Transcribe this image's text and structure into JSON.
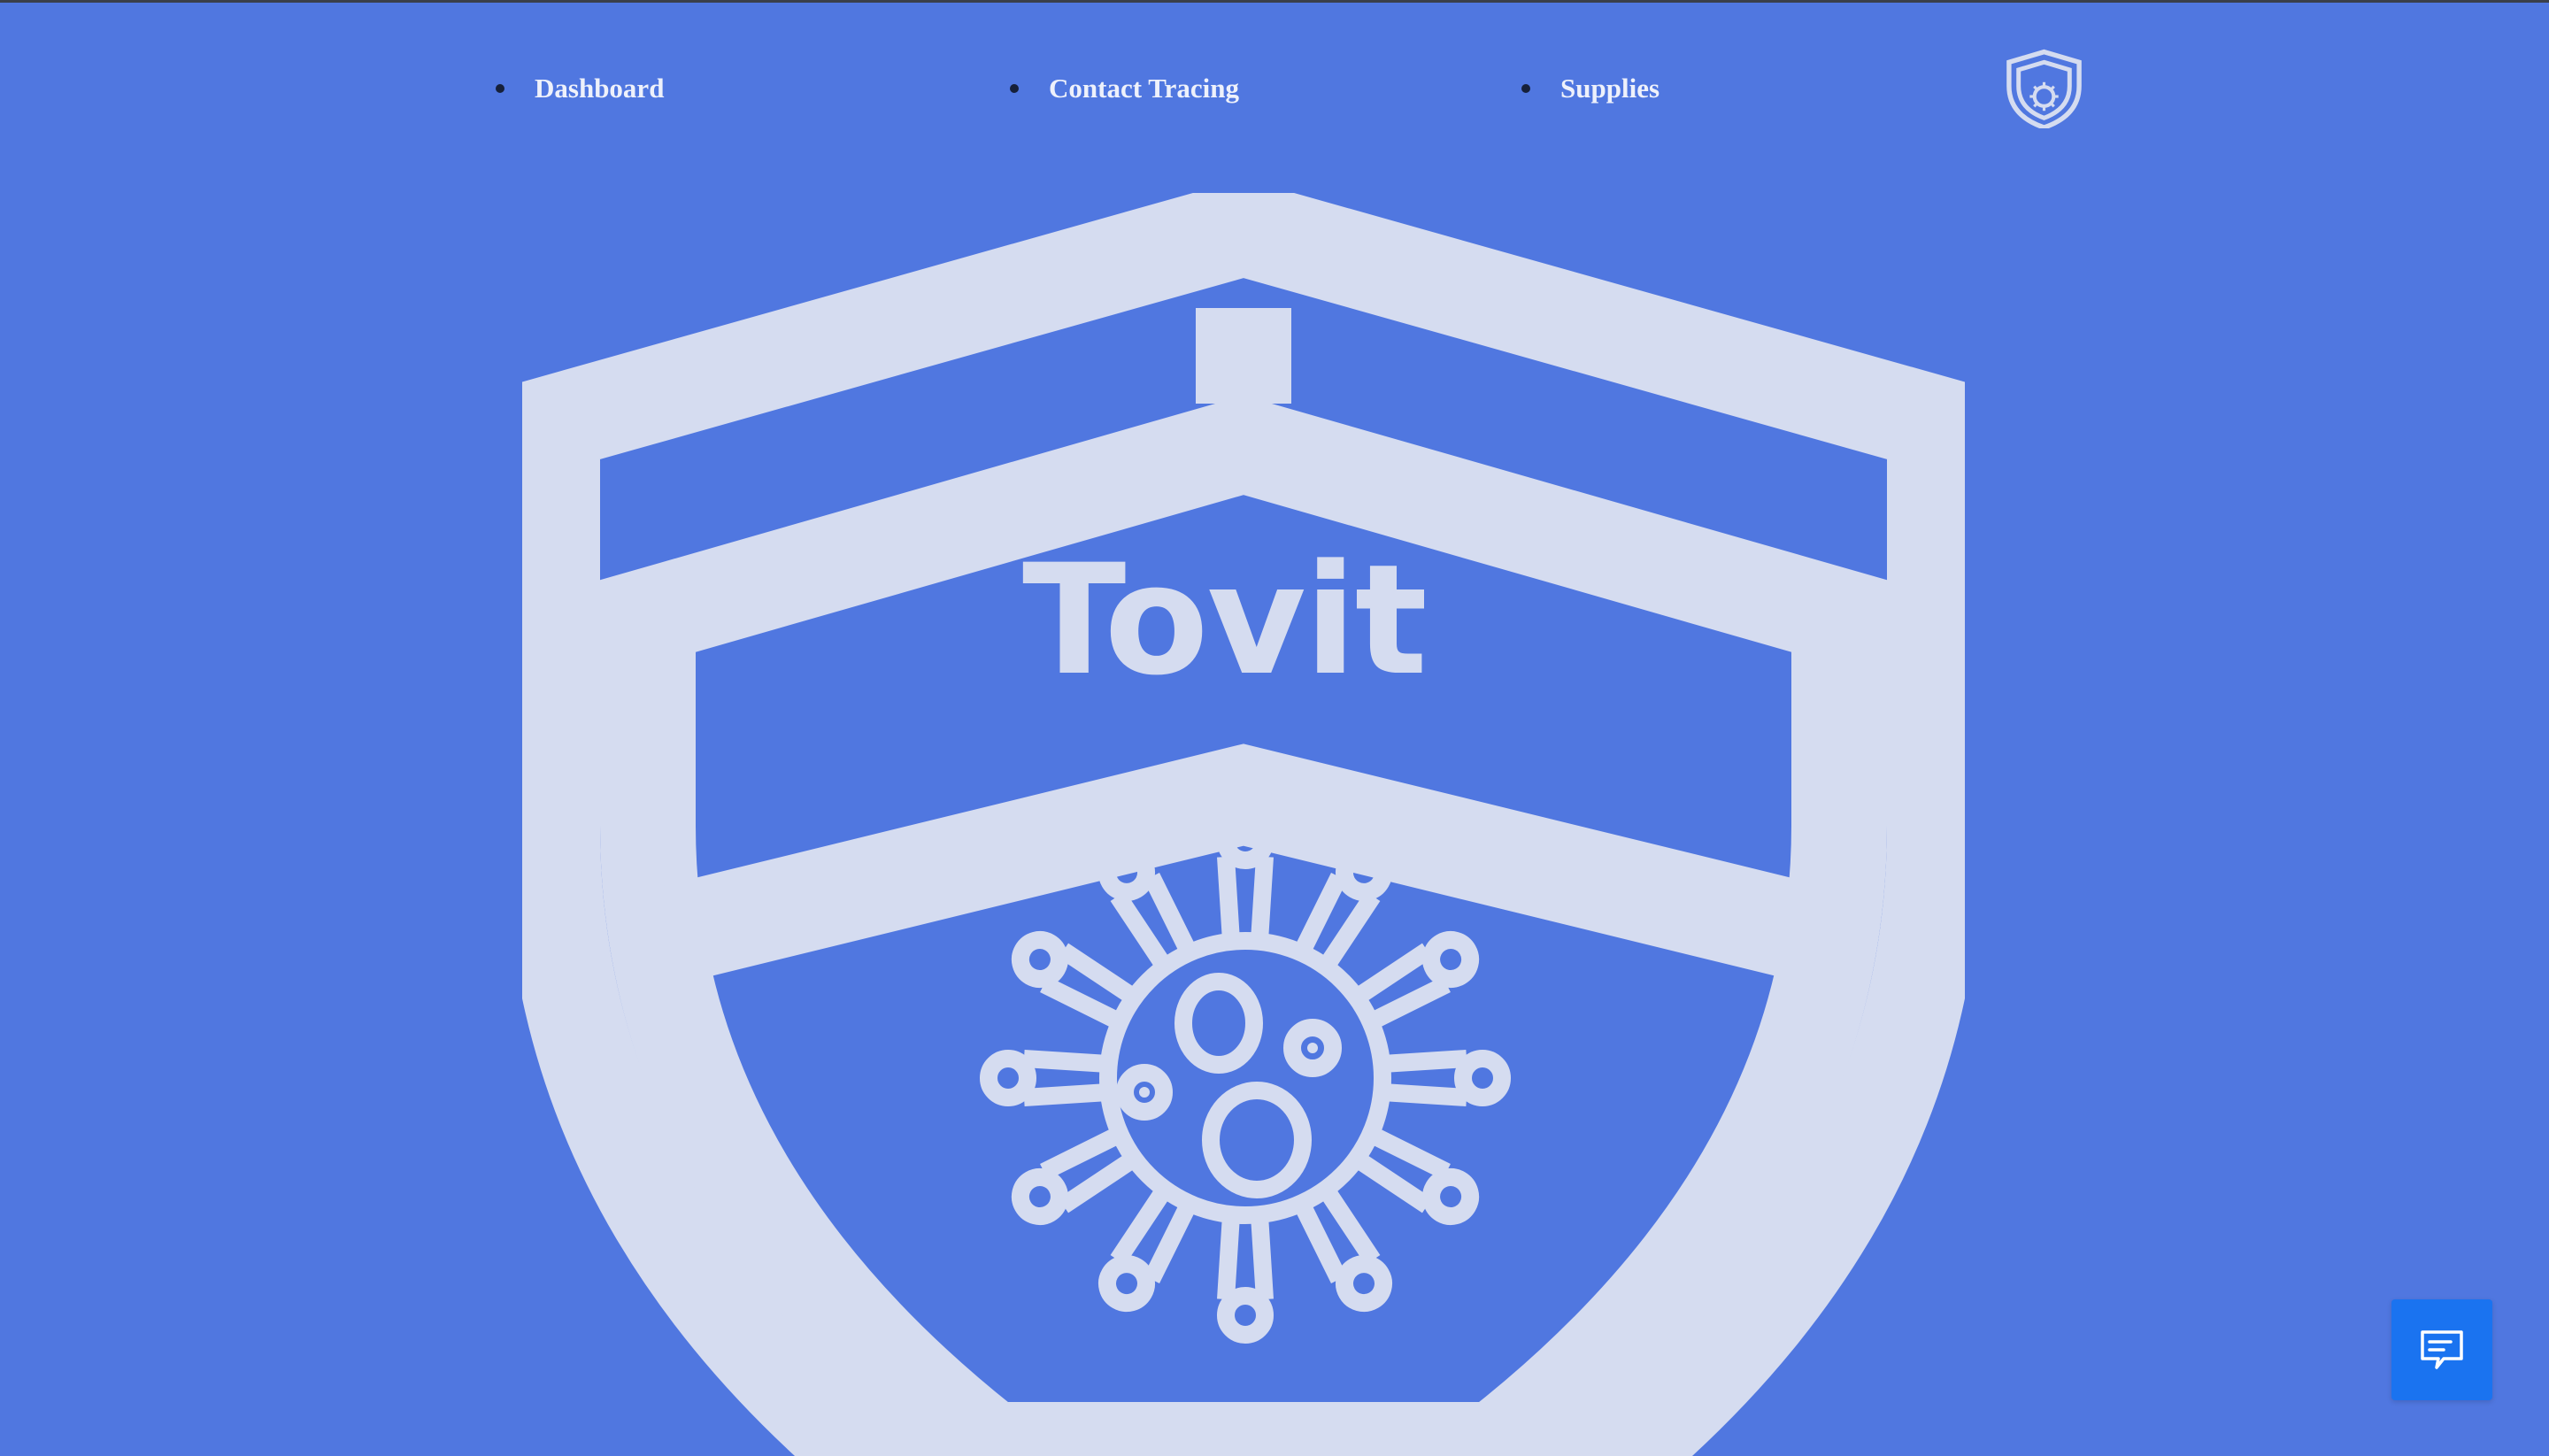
{
  "nav": {
    "items": [
      {
        "label": "Dashboard"
      },
      {
        "label": "Contact Tracing"
      },
      {
        "label": "Supplies"
      }
    ]
  },
  "hero": {
    "title": "Tovit"
  },
  "icons": {
    "logo": "shield-virus-logo-icon",
    "hero": "shield-virus-icon",
    "chat": "chat-bubble-icon"
  },
  "colors": {
    "background": "#5077e0",
    "shield": "#d5dcf0",
    "chat_button": "#1a73f0",
    "nav_text": "#eef1fb"
  }
}
